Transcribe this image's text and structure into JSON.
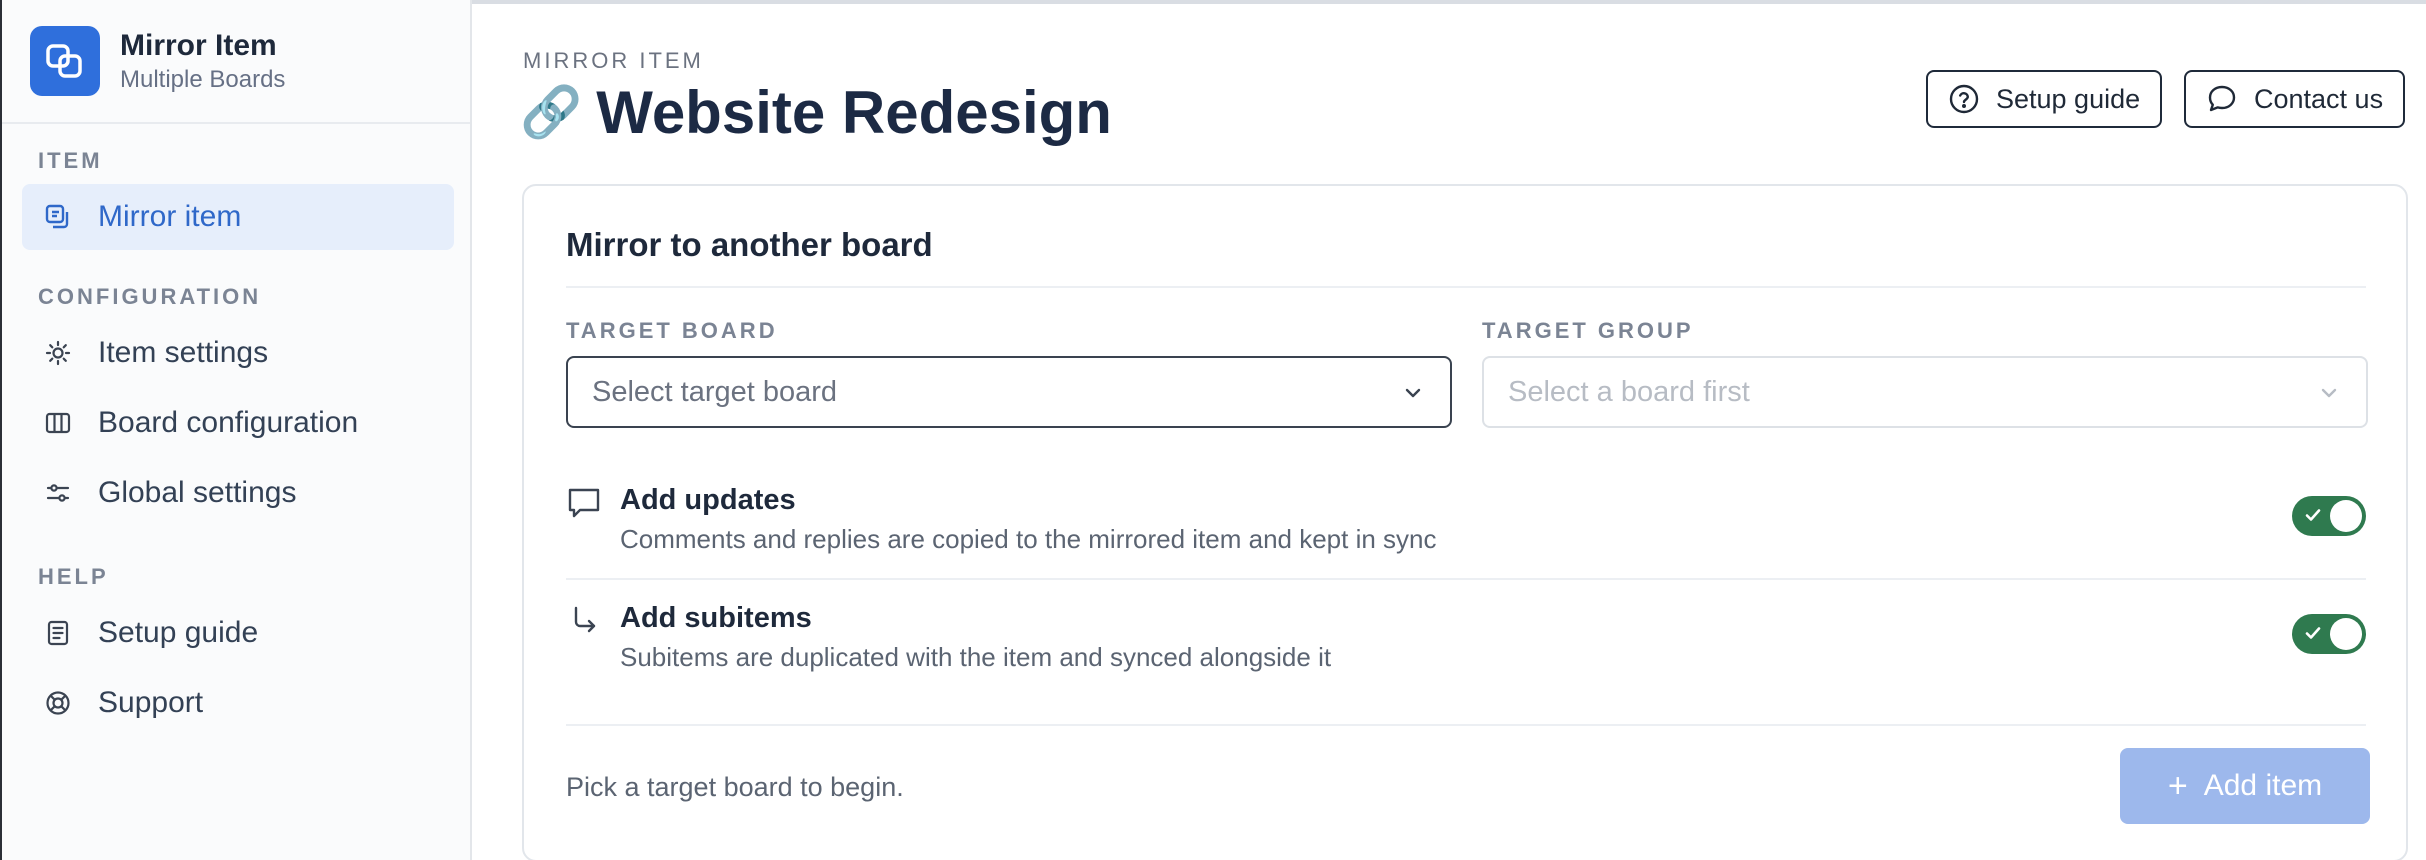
{
  "app": {
    "name": "Mirror Item",
    "subtitle": "Multiple Boards",
    "brand_color": "#2f6fdc"
  },
  "sidebar": {
    "sections": [
      {
        "label": "ITEM"
      },
      {
        "label": "CONFIGURATION"
      },
      {
        "label": "HELP"
      }
    ],
    "items": [
      {
        "label": "Mirror item",
        "icon": "mirror-icon",
        "active": true
      },
      {
        "label": "Item settings",
        "icon": "sun-gear-icon"
      },
      {
        "label": "Board configuration",
        "icon": "columns-icon"
      },
      {
        "label": "Global settings",
        "icon": "sliders-icon"
      },
      {
        "label": "Setup guide",
        "icon": "document-icon"
      },
      {
        "label": "Support",
        "icon": "lifebuoy-icon"
      }
    ]
  },
  "header": {
    "eyebrow": "MIRROR ITEM",
    "title_emoji": "🔗",
    "title": "Website Redesign",
    "setup_guide_label": "Setup guide",
    "contact_label": "Contact us"
  },
  "card": {
    "title": "Mirror to another board",
    "target_board": {
      "label": "TARGET BOARD",
      "placeholder": "Select target board"
    },
    "target_group": {
      "label": "TARGET GROUP",
      "placeholder": "Select a board first"
    },
    "options": [
      {
        "title": "Add updates",
        "description": "Comments and replies are copied to the mirrored item and kept in sync",
        "enabled": true
      },
      {
        "title": "Add subitems",
        "description": "Subitems are duplicated with the item and synced alongside it",
        "enabled": true
      }
    ],
    "footer_hint": "Pick a target board to begin.",
    "add_button_label": "Add item"
  },
  "colors": {
    "accent": "#2f68c9",
    "toggle_on": "#2f7a4f",
    "button_disabled": "#9db8ec"
  }
}
